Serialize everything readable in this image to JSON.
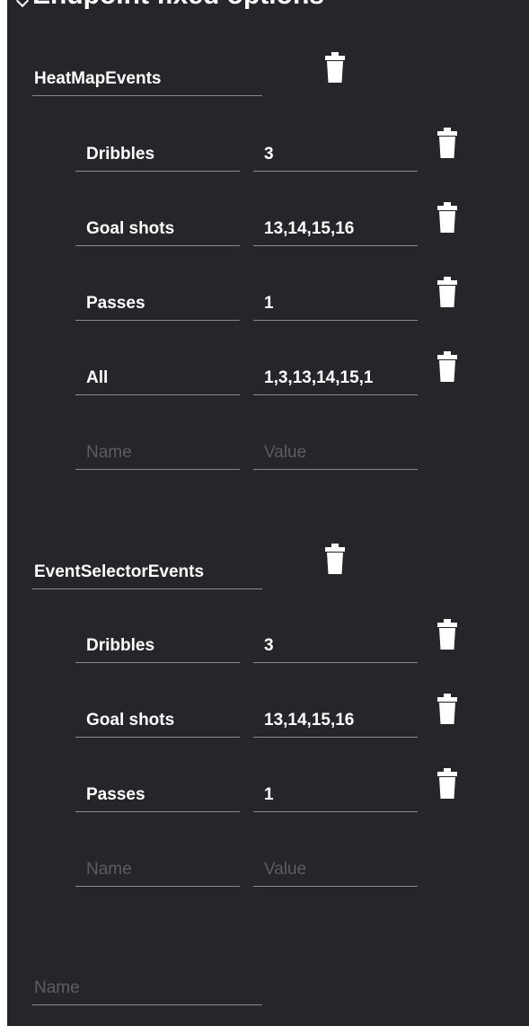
{
  "section": {
    "title": "Endpoint fixed options"
  },
  "groups": [
    {
      "name": "HeatMapEvents",
      "options": [
        {
          "name": "Dribbles",
          "value": "3"
        },
        {
          "name": "Goal shots",
          "value": "13,14,15,16"
        },
        {
          "name": "Passes",
          "value": "1"
        },
        {
          "name": "All",
          "value": "1,3,13,14,15,1"
        }
      ],
      "new_option": {
        "name_placeholder": "Name",
        "value_placeholder": "Value"
      }
    },
    {
      "name": "EventSelectorEvents",
      "options": [
        {
          "name": "Dribbles",
          "value": "3"
        },
        {
          "name": "Goal shots",
          "value": "13,14,15,16"
        },
        {
          "name": "Passes",
          "value": "1"
        }
      ],
      "new_option": {
        "name_placeholder": "Name",
        "value_placeholder": "Value"
      }
    }
  ],
  "new_group": {
    "name_placeholder": "Name"
  },
  "icons": {
    "delete": "trash-icon",
    "collapse": "chevron-down-icon"
  },
  "colors": {
    "panel_bg": "#252629",
    "text": "#ffffff",
    "underline": "#8a8a8a",
    "placeholder": "#5c5d62"
  }
}
